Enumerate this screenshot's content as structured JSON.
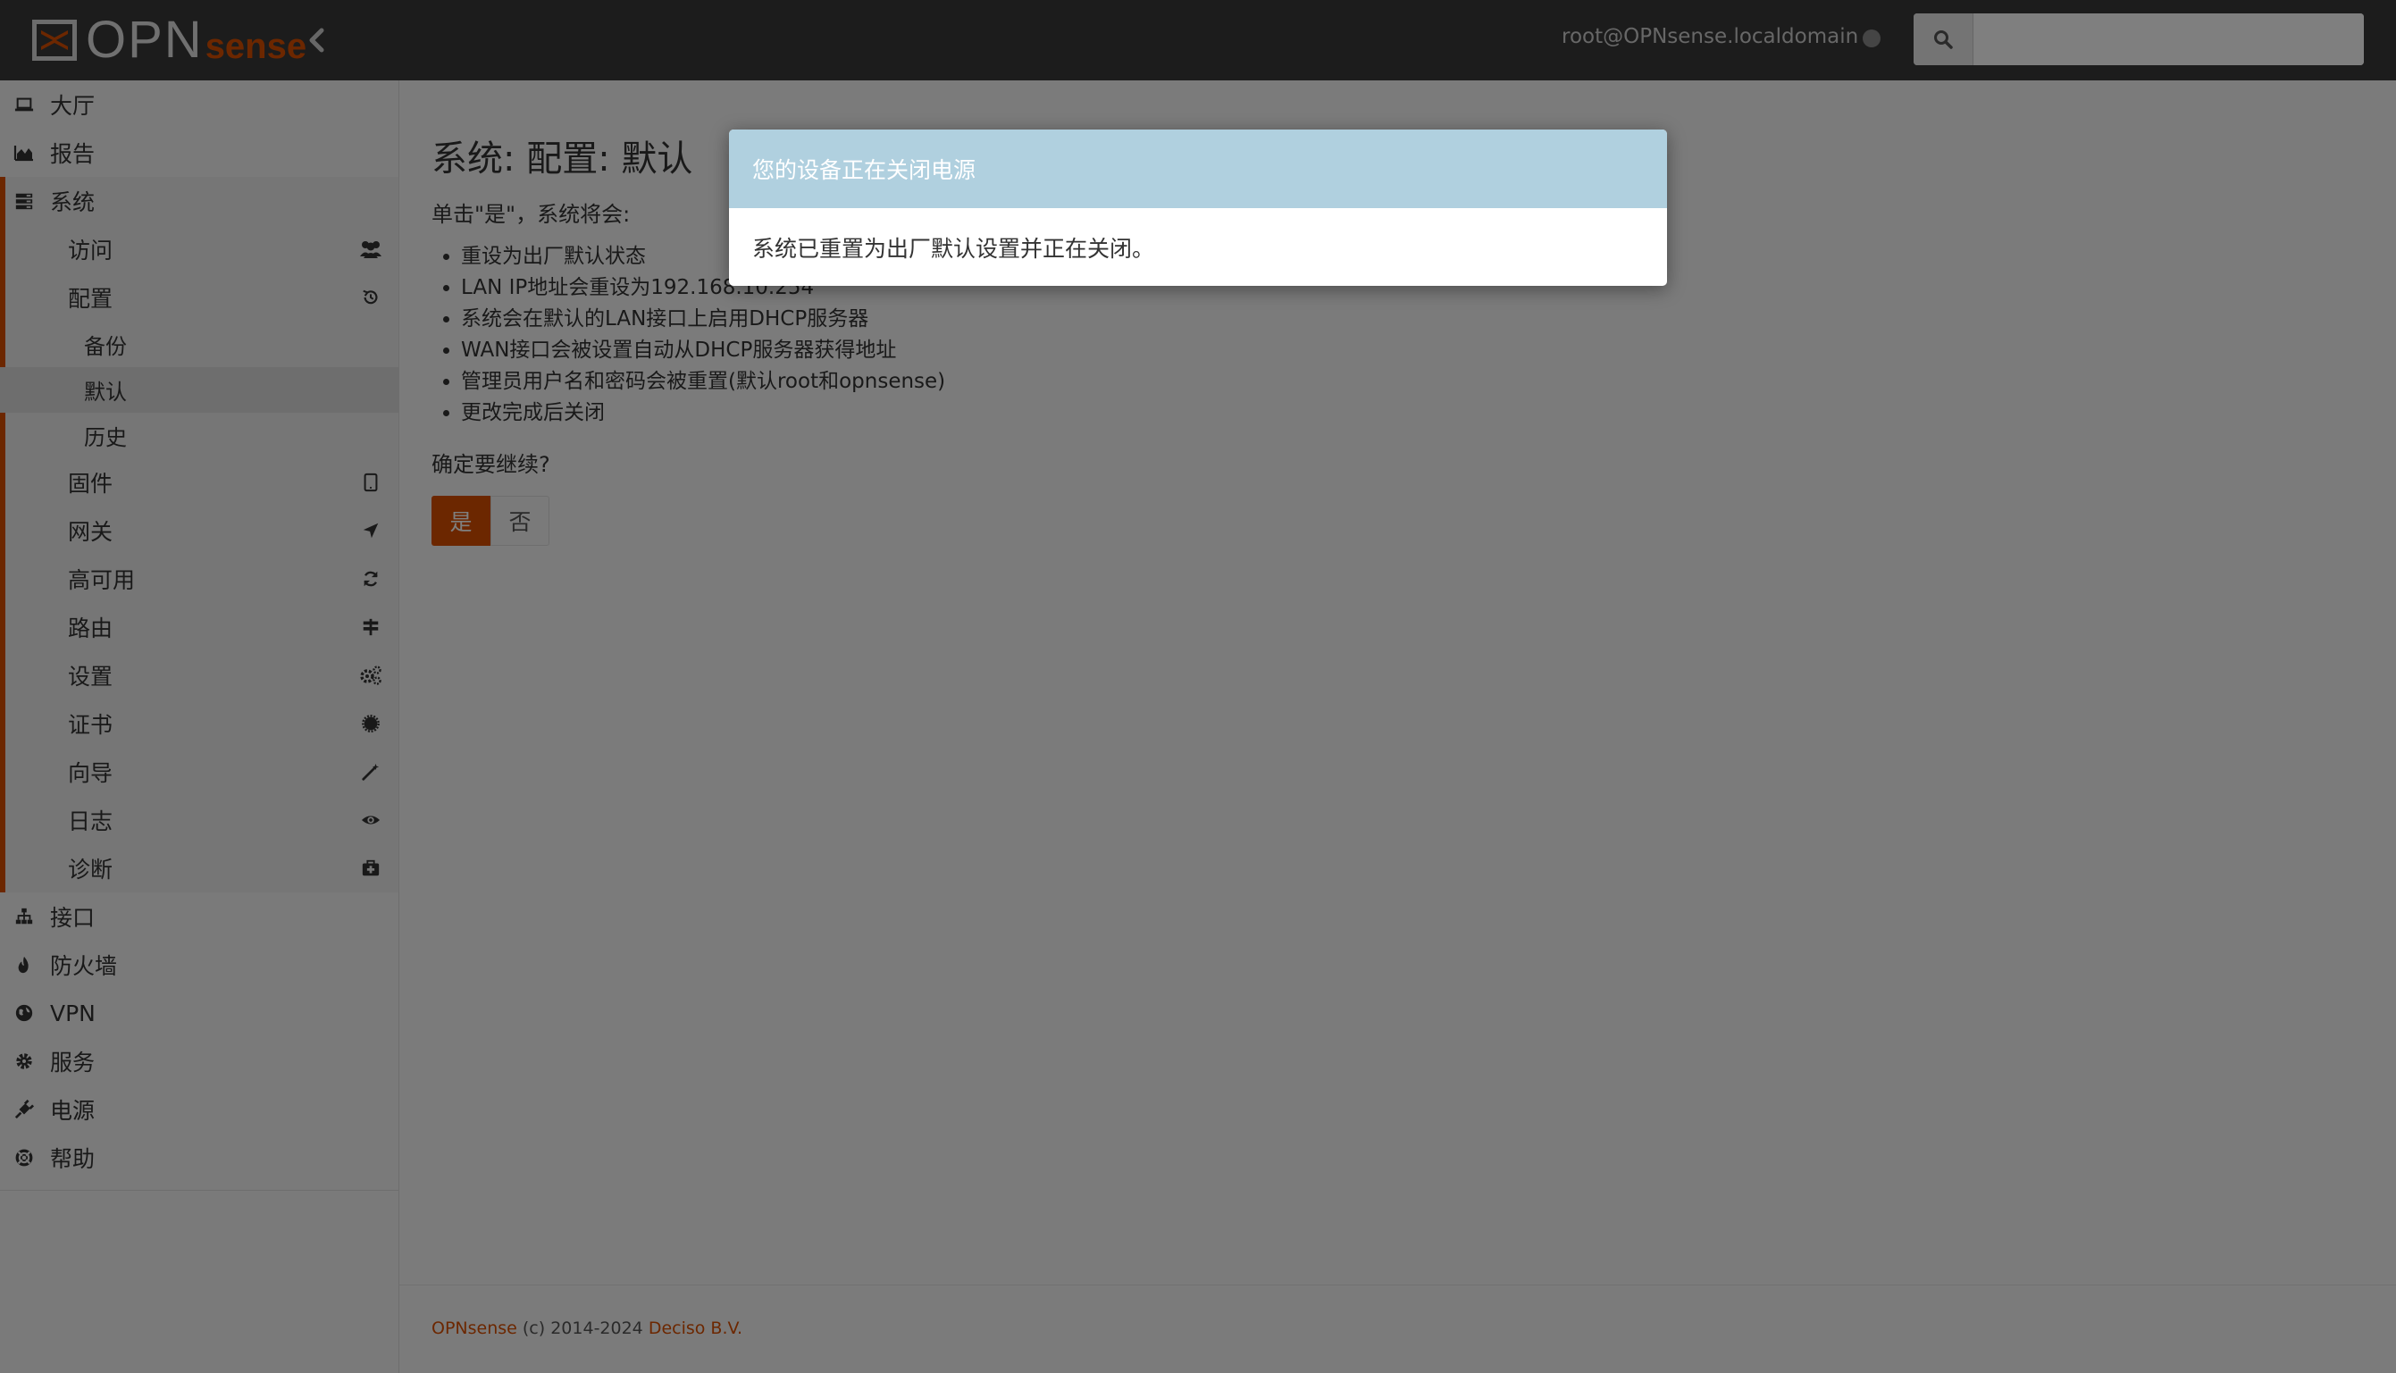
{
  "brand": {
    "opn": "OPN",
    "sense": "sense"
  },
  "topbar": {
    "user": "root@OPNsense.localdomain",
    "search_placeholder": ""
  },
  "sidebar": {
    "top_items": [
      {
        "label": "大厅",
        "icon": "laptop-icon"
      },
      {
        "label": "报告",
        "icon": "area-chart-icon"
      }
    ],
    "system": {
      "label": "系统",
      "icon": "server-icon",
      "children": [
        {
          "label": "访问",
          "icon": "users-icon"
        },
        {
          "label": "配置",
          "icon": "history-icon"
        }
      ],
      "config_children": [
        {
          "label": "备份"
        },
        {
          "label": "默认"
        },
        {
          "label": "历史"
        }
      ],
      "more_children": [
        {
          "label": "固件",
          "icon": "tablet-icon"
        },
        {
          "label": "网关",
          "icon": "location-arrow-icon"
        },
        {
          "label": "高可用",
          "icon": "refresh-icon"
        },
        {
          "label": "路由",
          "icon": "signpost-icon"
        },
        {
          "label": "设置",
          "icon": "cogs-icon"
        },
        {
          "label": "证书",
          "icon": "certificate-icon"
        },
        {
          "label": "向导",
          "icon": "magic-wand-icon"
        },
        {
          "label": "日志",
          "icon": "eye-icon"
        },
        {
          "label": "诊断",
          "icon": "medkit-icon"
        }
      ]
    },
    "bottom_items": [
      {
        "label": "接口",
        "icon": "sitemap-icon"
      },
      {
        "label": "防火墙",
        "icon": "fire-icon"
      },
      {
        "label": "VPN",
        "icon": "globe-icon"
      },
      {
        "label": "服务",
        "icon": "cog-icon"
      },
      {
        "label": "电源",
        "icon": "plug-icon"
      },
      {
        "label": "帮助",
        "icon": "life-ring-icon"
      }
    ]
  },
  "main": {
    "title": "系统: 配置: 默认",
    "intro": "单击\"是\"，系统将会:",
    "bullets": [
      "重设为出厂默认状态",
      "LAN IP地址会重设为192.168.10.254",
      "系统会在默认的LAN接口上启用DHCP服务器",
      "WAN接口会被设置自动从DHCP服务器获得地址",
      "管理员用户名和密码会被重置(默认root和opnsense)",
      "更改完成后关闭"
    ],
    "confirm": "确定要继续?",
    "yes_label": "是",
    "no_label": "否"
  },
  "footer": {
    "brand_link": "OPNsense",
    "copyright": " (c) 2014-2024 ",
    "company_link": "Deciso B.V."
  },
  "modal": {
    "title": "您的设备正在关闭电源",
    "message": "系统已重置为出厂默认设置并正在关闭。"
  },
  "colors": {
    "accent": "#d94f00",
    "topbar": "#383838",
    "modal_header": "#b0d0df"
  }
}
